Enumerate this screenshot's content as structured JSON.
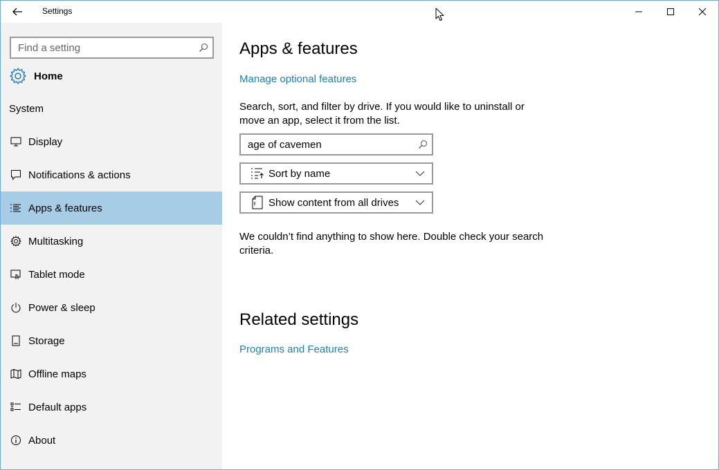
{
  "window": {
    "title": "Settings"
  },
  "sidebar": {
    "search_placeholder": "Find a setting",
    "home_label": "Home",
    "section_label": "System",
    "items": [
      {
        "label": "Display",
        "icon": "monitor-icon"
      },
      {
        "label": "Notifications & actions",
        "icon": "speech-bubble-icon"
      },
      {
        "label": "Apps & features",
        "icon": "list-icon",
        "active": true
      },
      {
        "label": "Multitasking",
        "icon": "gear-icon"
      },
      {
        "label": "Tablet mode",
        "icon": "tablet-icon"
      },
      {
        "label": "Power & sleep",
        "icon": "power-icon"
      },
      {
        "label": "Storage",
        "icon": "storage-icon"
      },
      {
        "label": "Offline maps",
        "icon": "map-icon"
      },
      {
        "label": "Default apps",
        "icon": "grid-list-icon"
      },
      {
        "label": "About",
        "icon": "info-icon"
      }
    ]
  },
  "main": {
    "title": "Apps & features",
    "manage_link": "Manage optional features",
    "description": "Search, sort, and filter by drive. If you would like to uninstall or move an app, select it from the list.",
    "search_value": "age of cavemen",
    "sort_label": "Sort by name",
    "filter_label": "Show content from all drives",
    "empty_message": "We couldn’t find anything to show here. Double check your search criteria.",
    "related_title": "Related settings",
    "related_link": "Programs and Features"
  },
  "colors": {
    "accent": "#1a7fc1",
    "selected_bg": "#a6cce6",
    "sidebar_bg": "#f2f2f2"
  }
}
